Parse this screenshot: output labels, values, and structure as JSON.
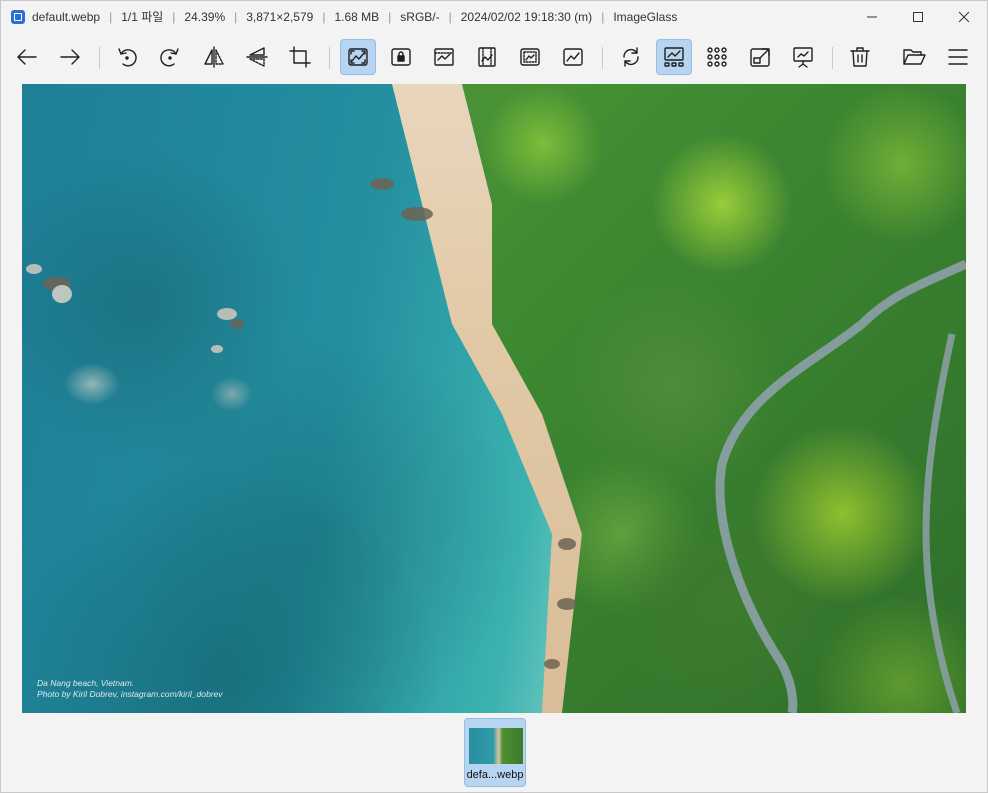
{
  "titlebar": {
    "segments": [
      "default.webp",
      "1/1 파일",
      "24.39%",
      "3,871×2,579",
      "1.68 MB",
      "sRGB/-",
      "2024/02/02 19:18:30 (m)",
      "ImageGlass"
    ]
  },
  "toolbar": {
    "buttons": [
      {
        "name": "back-icon",
        "active": false
      },
      {
        "name": "forward-icon",
        "active": false
      },
      {
        "name": "rotate-left-icon",
        "active": false
      },
      {
        "name": "rotate-right-icon",
        "active": false
      },
      {
        "name": "flip-horizontal-icon",
        "active": false
      },
      {
        "name": "flip-vertical-icon",
        "active": false
      },
      {
        "name": "crop-icon",
        "active": false
      },
      {
        "name": "auto-zoom-icon",
        "active": true
      },
      {
        "name": "lock-zoom-icon",
        "active": false
      },
      {
        "name": "scale-to-width-icon",
        "active": false
      },
      {
        "name": "scale-to-height-icon",
        "active": false
      },
      {
        "name": "scale-to-fit-icon",
        "active": false
      },
      {
        "name": "scale-to-fill-icon",
        "active": false
      },
      {
        "name": "refresh-icon",
        "active": false
      },
      {
        "name": "gallery-icon",
        "active": true
      },
      {
        "name": "thumbnail-grid-icon",
        "active": false
      },
      {
        "name": "fullscreen-icon",
        "active": false
      },
      {
        "name": "slideshow-icon",
        "active": false
      },
      {
        "name": "delete-icon",
        "active": false
      },
      {
        "name": "open-folder-icon",
        "active": false
      },
      {
        "name": "menu-icon",
        "active": false
      }
    ]
  },
  "viewer": {
    "caption_line1": "Da Nang beach, Vietnam.",
    "caption_line2": "Photo by Kiril Dobrev, instagram.com/kiril_dobrev"
  },
  "thumbnails": [
    {
      "label": "defa...webp",
      "selected": true
    }
  ]
}
